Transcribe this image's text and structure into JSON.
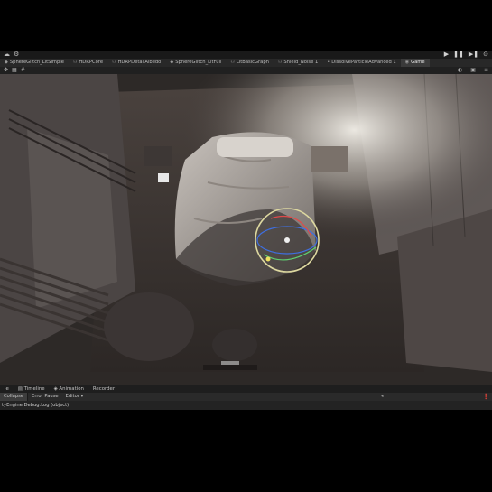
{
  "toolbar": {
    "left_icons": [
      "cloud-icon",
      "gear-icon"
    ],
    "play": "▶",
    "pause": "❚❚",
    "step": "▶❚",
    "account": "⊙"
  },
  "tabs": [
    {
      "label": "SphereGlitch_LitSimple"
    },
    {
      "label": "HDRPCore"
    },
    {
      "label": "HDRPDetailAlbedo"
    },
    {
      "label": "SphereGlitch_LitFull"
    },
    {
      "label": "LitBasicGraph"
    },
    {
      "label": "Shield_Noise 1"
    },
    {
      "label": "DissolveParticleAdvanced 1"
    },
    {
      "label": "Game"
    }
  ],
  "bottom_tabs": {
    "partial": "le",
    "timeline": "Timeline",
    "animation": "Animation",
    "recorder": "Recorder"
  },
  "console": {
    "collapse": "Collapse",
    "error_pause": "Error Pause",
    "editor": "Editor ▾",
    "log_text": "tyEngine.Debug.Log (object)"
  }
}
